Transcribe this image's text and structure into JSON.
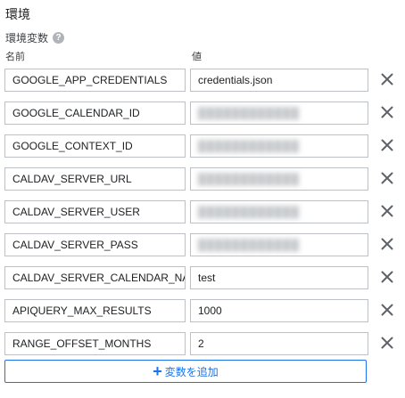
{
  "section": {
    "title": "環境"
  },
  "env": {
    "label": "環境変数",
    "help_icon": "help-circle-icon"
  },
  "columns": {
    "name": "名前",
    "value": "値"
  },
  "rows": [
    {
      "name": "GOOGLE_APP_CREDENTIALS",
      "value": "credentials.json",
      "blurred": false
    },
    {
      "name": "GOOGLE_CALENDAR_ID",
      "value": "",
      "blurred": true
    },
    {
      "name": "GOOGLE_CONTEXT_ID",
      "value": "",
      "blurred": true
    },
    {
      "name": "CALDAV_SERVER_URL",
      "value": "",
      "blurred": true
    },
    {
      "name": "CALDAV_SERVER_USER",
      "value": "",
      "blurred": true
    },
    {
      "name": "CALDAV_SERVER_PASS",
      "value": "",
      "blurred": true
    },
    {
      "name": "CALDAV_SERVER_CALENDAR_NAI",
      "value": "test",
      "blurred": false
    },
    {
      "name": "APIQUERY_MAX_RESULTS",
      "value": "1000",
      "blurred": false
    },
    {
      "name": "RANGE_OFFSET_MONTHS",
      "value": "2",
      "blurred": false
    }
  ],
  "add_button": {
    "label": "変数を追加",
    "icon": "plus-icon"
  },
  "colors": {
    "accent": "#1a73e8",
    "border": "#bdc1c6",
    "icon": "#5f6368"
  }
}
